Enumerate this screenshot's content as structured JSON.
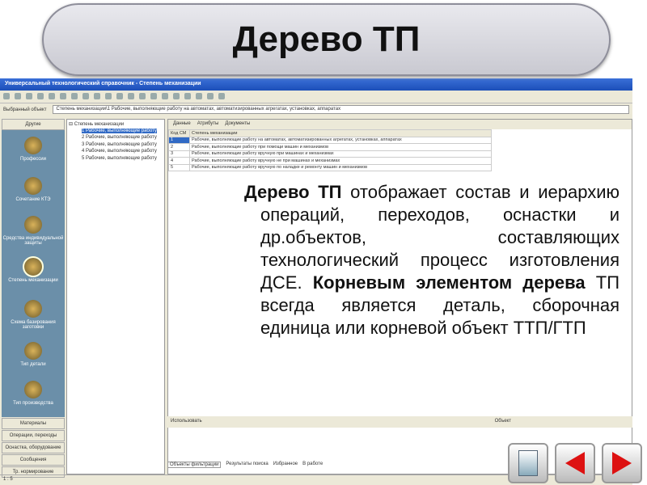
{
  "slide": {
    "title": "Дерево ТП",
    "text_p1": "Дерево ТП",
    "text_p2": " отображает состав и иерархию операций, переходов, оснастки и др.объектов, составляющих технологический процесс изготовления ДСЕ. ",
    "text_bold": "Корневым элементом дерева",
    "text_p3": " ТП всегда является деталь, сборочная единица или корневой объект ТТП/ГТП"
  },
  "window": {
    "title": "Универсальный технологический справочник - Степень механизации",
    "selected_label": "Выбранный объект",
    "selected_value": "Степень механизации\\1 Рабочие, выполняющие работу на автоматах, автоматизированных агрегатах, установках, аппаратах",
    "sidebar": {
      "header": "Другие",
      "icons": [
        "Профессии",
        "Сочетание КТЭ",
        "Средства индивидуальной защиты",
        "Степень механизации",
        "Схема базирования заготовки",
        "Тип детали",
        "Тип производства"
      ],
      "buttons": [
        "Материалы",
        "Операции, переходы",
        "Оснастка, оборудование",
        "Сообщения",
        "Тр. нормирование"
      ]
    },
    "tree": {
      "root": "Степень механизации",
      "items": [
        "1 Рабочие, выполняющие работу",
        "2 Рабочие, выполняющие работу",
        "3 Рабочие, выполняющие работу",
        "4 Рабочие, выполняющие работу",
        "5 Рабочие, выполняющие работу"
      ]
    },
    "tabs": [
      "Данные",
      "Атрибуты",
      "Документы"
    ],
    "table": {
      "headers": [
        "Код СМ",
        "Степень механизации"
      ],
      "rows": [
        [
          "1",
          "Рабочие, выполняющие работу на автоматах, автоматизированных агрегатах, установках, аппаратах"
        ],
        [
          "2",
          "Рабочие, выполняющие работу при помощи машин и механизмов"
        ],
        [
          "3",
          "Рабочие, выполняющие работу вручную при машинах и механизмах"
        ],
        [
          "4",
          "Рабочие, выполняющие работу вручную не при машинах и механизмах"
        ],
        [
          "5",
          "Рабочие, выполняющие работу вручную по наладке и ремонту машин и механизмов"
        ]
      ]
    },
    "lower_headers": [
      "Использовать",
      "Объект"
    ],
    "bottom_tabs": [
      "Объекты фильтрации",
      "Результаты поиска",
      "Избранное",
      "В работе"
    ],
    "status": "1 : 5"
  }
}
